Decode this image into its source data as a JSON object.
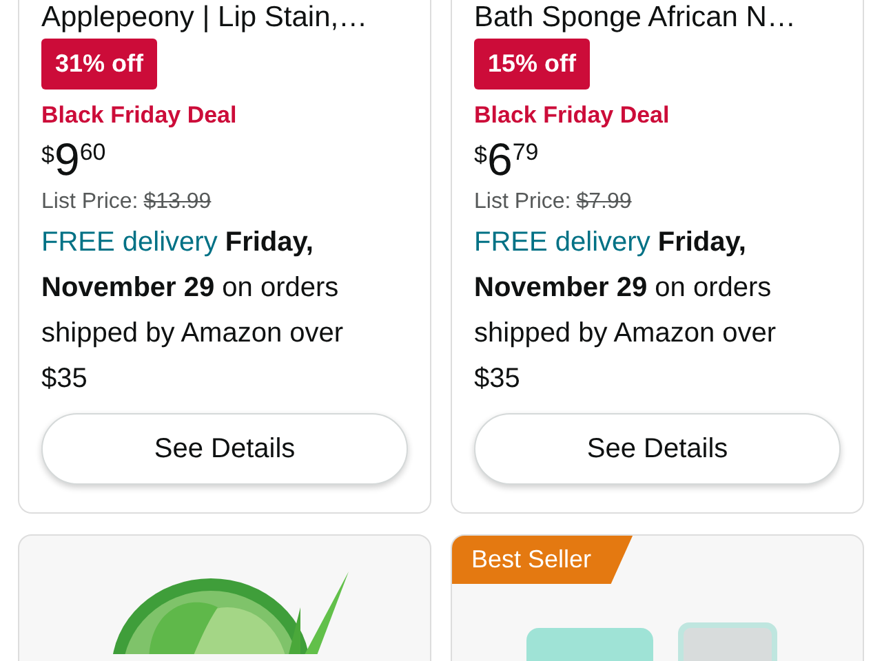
{
  "deals": [
    {
      "title": "Applepeony | Lip Stain,…",
      "discount": "31% off",
      "deal_label": "Black Friday Deal",
      "price": {
        "symbol": "$",
        "whole": "9",
        "fraction": "60"
      },
      "list_price": {
        "label": "List Price:",
        "value": "$13.99"
      },
      "delivery": {
        "prefix": "FREE delivery",
        "rest": "**Friday, November 29** on orders shipped by Amazon over $35"
      },
      "button": "See Details"
    },
    {
      "title": "Bath Sponge African N…",
      "discount": "15% off",
      "deal_label": "Black Friday Deal",
      "price": {
        "symbol": "$",
        "whole": "6",
        "fraction": "79"
      },
      "list_price": {
        "label": "List Price:",
        "value": "$7.99"
      },
      "delivery": {
        "prefix": "FREE delivery",
        "rest": "**Friday, November 29** on orders shipped by Amazon over $35"
      },
      "button": "See Details"
    }
  ],
  "next_items": [
    {
      "kind": "eye-patches"
    },
    {
      "kind": "mirror",
      "badge": "Best Seller"
    }
  ]
}
